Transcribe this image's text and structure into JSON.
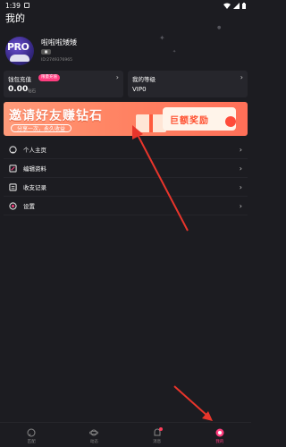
{
  "status_bar": {
    "time": "1:39"
  },
  "page": {
    "title": "我的"
  },
  "profile": {
    "avatar_text": "PRO",
    "nickname": "啦啦啦矮矮",
    "badge": "■",
    "uid": "ID:2749376965"
  },
  "wallet": {
    "label": "钱包充值",
    "pill": "限量充值",
    "value": "0.00",
    "unit": "钻石"
  },
  "level": {
    "label": "我的等级",
    "value": "VIP0"
  },
  "banner": {
    "title": "邀请好友赚钻石",
    "subtitle": "分享一次，永久收益",
    "prize": "巨额奖励"
  },
  "menu": [
    {
      "label": "个人主页",
      "icon": "user-icon"
    },
    {
      "label": "编辑资料",
      "icon": "edit-icon"
    },
    {
      "label": "收支记录",
      "icon": "record-icon"
    },
    {
      "label": "设置",
      "icon": "settings-icon"
    }
  ],
  "tabs": [
    {
      "label": "匹配",
      "icon": "match-icon"
    },
    {
      "label": "动态",
      "icon": "planet-icon"
    },
    {
      "label": "消息",
      "icon": "message-icon"
    },
    {
      "label": "我的",
      "icon": "profile-icon"
    }
  ],
  "colors": {
    "accent": "#ff3d7f",
    "background": "#1c1c21",
    "card": "#26262c",
    "banner": "#ff8665"
  }
}
